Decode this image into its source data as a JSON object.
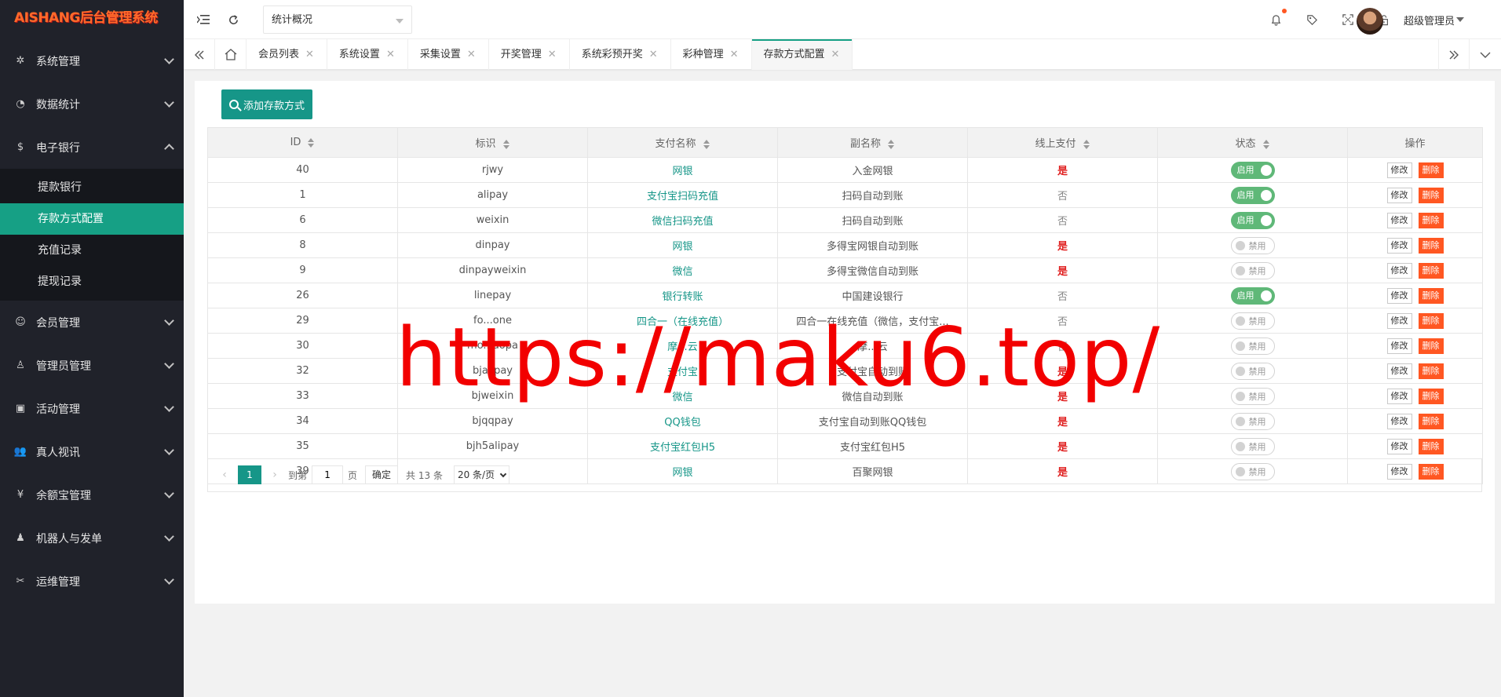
{
  "app": {
    "logo_text": "AISHANG后台管理系统"
  },
  "sidebar": {
    "items": [
      {
        "label": "系统管理",
        "icon": "gear-icon",
        "glyph": "✲"
      },
      {
        "label": "数据统计",
        "icon": "dashboard-icon",
        "glyph": "◔"
      },
      {
        "label": "电子银行",
        "icon": "dollar-icon",
        "glyph": "$"
      },
      {
        "label": "会员管理",
        "icon": "user-icon",
        "glyph": "☺"
      },
      {
        "label": "管理员管理",
        "icon": "admin-icon",
        "glyph": "♙"
      },
      {
        "label": "活动管理",
        "icon": "gift-icon",
        "glyph": "▣"
      },
      {
        "label": "真人视讯",
        "icon": "users-icon",
        "glyph": "👥"
      },
      {
        "label": "余额宝管理",
        "icon": "yen-icon",
        "glyph": "¥"
      },
      {
        "label": "机器人与发单",
        "icon": "robot-icon",
        "glyph": "♟"
      },
      {
        "label": "运维管理",
        "icon": "wrench-icon",
        "glyph": "✂"
      }
    ],
    "submenu": [
      "提款银行",
      "存款方式配置",
      "充值记录",
      "提现记录"
    ]
  },
  "header": {
    "quick_select": "统计概况",
    "user_name": "超级管理员"
  },
  "tabs": [
    "会员列表",
    "系统设置",
    "采集设置",
    "开奖管理",
    "系统彩预开奖",
    "彩种管理",
    "存款方式配置"
  ],
  "content": {
    "add_button": "添加存款方式",
    "columns": [
      "ID",
      "标识",
      "支付名称",
      "副名称",
      "线上支付",
      "状态",
      "操作"
    ],
    "rows": [
      {
        "id": "40",
        "code": "rjwy",
        "name": "网银",
        "sub": "入金网银",
        "online": "是",
        "status": "启用",
        "on": true
      },
      {
        "id": "1",
        "code": "alipay",
        "name": "支付宝扫码充值",
        "sub": "扫码自动到账",
        "online": "否",
        "status": "启用",
        "on": true
      },
      {
        "id": "6",
        "code": "weixin",
        "name": "微信扫码充值",
        "sub": "扫码自动到账",
        "online": "否",
        "status": "启用",
        "on": true
      },
      {
        "id": "8",
        "code": "dinpay",
        "name": "网银",
        "sub": "多得宝网银自动到账",
        "online": "是",
        "status": "禁用",
        "on": false
      },
      {
        "id": "9",
        "code": "dinpayweixin",
        "name": "微信",
        "sub": "多得宝微信自动到账",
        "online": "是",
        "status": "禁用",
        "on": false
      },
      {
        "id": "26",
        "code": "linepay",
        "name": "银行转账",
        "sub": "中国建设银行",
        "online": "否",
        "status": "启用",
        "on": true
      },
      {
        "id": "29",
        "code": "fo...one",
        "name": "四合一（在线充值）",
        "sub": "四合一在线充值（微信，支付宝...",
        "online": "否",
        "status": "禁用",
        "on": false
      },
      {
        "id": "30",
        "code": "mo...aopa",
        "name": "摩...云",
        "sub": "摩...云",
        "online": "否",
        "status": "禁用",
        "on": false
      },
      {
        "id": "32",
        "code": "bjalipay",
        "name": "支付宝",
        "sub": "支付宝自动到账",
        "online": "是",
        "status": "禁用",
        "on": false
      },
      {
        "id": "33",
        "code": "bjweixin",
        "name": "微信",
        "sub": "微信自动到账",
        "online": "是",
        "status": "禁用",
        "on": false
      },
      {
        "id": "34",
        "code": "bjqqpay",
        "name": "QQ钱包",
        "sub": "支付宝自动到账QQ钱包",
        "online": "是",
        "status": "禁用",
        "on": false
      },
      {
        "id": "35",
        "code": "bjh5alipay",
        "name": "支付宝红包H5",
        "sub": "支付宝红包H5",
        "online": "是",
        "status": "禁用",
        "on": false
      },
      {
        "id": "39",
        "code": "bjwy",
        "name": "网银",
        "sub": "百聚网银",
        "online": "是",
        "status": "禁用",
        "on": false
      }
    ],
    "edit_label": "修改",
    "delete_label": "删除"
  },
  "pagination": {
    "current": "1",
    "goto_label": "到第",
    "page_input": "1",
    "page_unit": "页",
    "confirm": "确定",
    "total": "共 13 条",
    "page_size": "20 条/页"
  },
  "watermark": "https://maku6.top/",
  "colors": {
    "accent": "#169688",
    "sidebar": "#20222a",
    "danger": "#ff5722",
    "switch_on": "#5fb878"
  }
}
